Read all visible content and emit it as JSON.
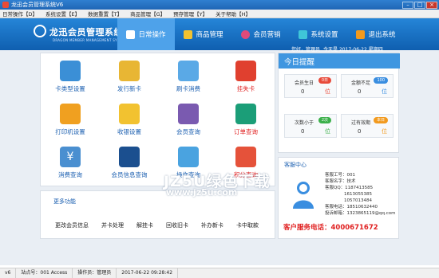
{
  "window": {
    "title": "龙迅会员管理系统V6"
  },
  "menu": [
    "日常操作【D】",
    "系统设置【E】",
    "数据重置【T】",
    "商品管理【G】",
    "预存管理【Y】",
    "关于帮助【H】"
  ],
  "brand": {
    "name": "龙迅会员管理系统",
    "sub": "DRAGON MEMBER MANAGEMENT SYSTEM"
  },
  "nav": [
    "日常操作",
    "商品管理",
    "会员营销",
    "系统设置",
    "退出系统"
  ],
  "header_info": {
    "greeting": "您好，管理员",
    "today_label": "今天是",
    "date": "2017-06-22",
    "weekday": "星期四"
  },
  "tiles": [
    {
      "label": "卡类型设置",
      "icon": "cards-icon",
      "color": "#3b8fd6"
    },
    {
      "label": "发行新卡",
      "icon": "new-card-icon",
      "color": "#e8b634"
    },
    {
      "label": "刷卡消费",
      "icon": "swipe-card-icon",
      "color": "#5aa9e6"
    },
    {
      "label": "挂失卡",
      "icon": "lost-card-icon",
      "color": "#e0402f"
    },
    {
      "label": "打印机设置",
      "icon": "printer-icon",
      "color": "#f0a020"
    },
    {
      "label": "收银设置",
      "icon": "cash-register-icon",
      "color": "#f2c230"
    },
    {
      "label": "会员查询",
      "icon": "member-search-icon",
      "color": "#7a5ab0"
    },
    {
      "label": "订单查询",
      "icon": "order-search-icon",
      "color": "#1b9e78"
    },
    {
      "label": "消费查询",
      "icon": "yen-icon",
      "color": "#4a8fd0"
    },
    {
      "label": "会员信息查询",
      "icon": "member-info-icon",
      "color": "#1b4f8f"
    },
    {
      "label": "操作查询",
      "icon": "operation-icon",
      "color": "#4aa3e0"
    },
    {
      "label": "积分查询",
      "icon": "points-search-icon",
      "color": "#e5523a"
    }
  ],
  "more": {
    "title": "更多功能",
    "links": [
      "更改会员信息",
      "并卡处理",
      "解挂卡",
      "回收旧卡",
      "补办新卡",
      "卡中取款"
    ]
  },
  "today": {
    "title": "今日提醒",
    "stats": [
      {
        "name": "会员生日",
        "badge": "0日",
        "badge_color": "#e84a3a",
        "value": "0",
        "unit": "位",
        "unit_color": "#e84a3a"
      },
      {
        "name": "金额不足",
        "badge": "100",
        "badge_color": "#3a8ee0",
        "value": "0",
        "unit": "位",
        "unit_color": "#3a8ee0"
      },
      {
        "name": "次数小于",
        "badge": "2次",
        "badge_color": "#3bb04a",
        "value": "0",
        "unit": "位",
        "unit_color": "#3bb04a"
      },
      {
        "name": "过有效期",
        "badge": "本日",
        "badge_color": "#f29a1e",
        "value": "0",
        "unit": "位",
        "unit_color": "#f29a1e"
      }
    ]
  },
  "service": {
    "title": "客服中心",
    "lines": [
      "客服工号：001",
      "客服名字：技术",
      "客服QQ：1187413585",
      "1613055385",
      "1057013484",
      "客服电话：18510632440",
      "投诉邮箱：1323865119@qq.com"
    ],
    "hotline": "客户服务电话：4000671672"
  },
  "watermark": {
    "main": "JZ5U绿色下载",
    "sub": "www.jz5u.com"
  },
  "status": [
    "v6",
    "站点号：001 Access",
    "操作员：管理员",
    "2017-06-22 09:28:42"
  ]
}
